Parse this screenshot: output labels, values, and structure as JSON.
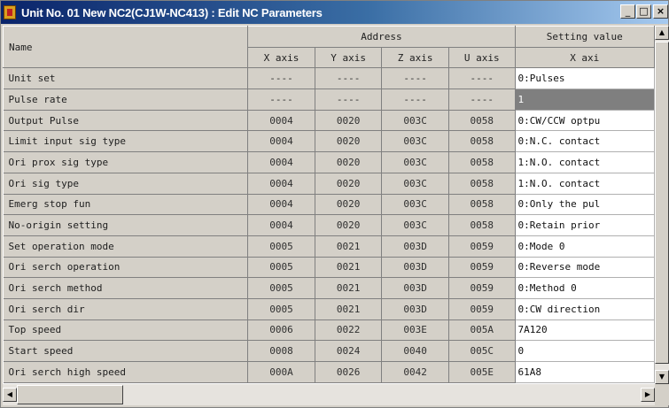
{
  "window": {
    "title": "Unit No. 01 New NC2(CJ1W-NC413) : Edit NC Parameters",
    "buttons": {
      "minimize": "_",
      "maximize": "□",
      "close": "×"
    }
  },
  "grid": {
    "headers": {
      "name": "Name",
      "address": "Address",
      "setting": "Setting value",
      "axes": [
        "X axis",
        "Y axis",
        "Z axis",
        "U axis"
      ],
      "setting_axis": "X axi"
    },
    "rows": [
      {
        "name": "Unit set",
        "addr": [
          "----",
          "----",
          "----",
          "----"
        ],
        "value": "0:Pulses",
        "selected": false
      },
      {
        "name": "Pulse rate",
        "addr": [
          "----",
          "----",
          "----",
          "----"
        ],
        "value": "1",
        "selected": true
      },
      {
        "name": "Output Pulse",
        "addr": [
          "0004",
          "0020",
          "003C",
          "0058"
        ],
        "value": "0:CW/CCW optpu",
        "selected": false
      },
      {
        "name": "Limit input sig type",
        "addr": [
          "0004",
          "0020",
          "003C",
          "0058"
        ],
        "value": "0:N.C. contact",
        "selected": false
      },
      {
        "name": "Ori prox sig type",
        "addr": [
          "0004",
          "0020",
          "003C",
          "0058"
        ],
        "value": "1:N.O. contact",
        "selected": false
      },
      {
        "name": "Ori sig type",
        "addr": [
          "0004",
          "0020",
          "003C",
          "0058"
        ],
        "value": "1:N.O. contact",
        "selected": false
      },
      {
        "name": "Emerg stop fun",
        "addr": [
          "0004",
          "0020",
          "003C",
          "0058"
        ],
        "value": "0:Only the pul",
        "selected": false
      },
      {
        "name": "No-origin setting",
        "addr": [
          "0004",
          "0020",
          "003C",
          "0058"
        ],
        "value": "0:Retain prior",
        "selected": false
      },
      {
        "name": "Set operation mode",
        "addr": [
          "0005",
          "0021",
          "003D",
          "0059"
        ],
        "value": "0:Mode 0",
        "selected": false
      },
      {
        "name": "Ori serch operation",
        "addr": [
          "0005",
          "0021",
          "003D",
          "0059"
        ],
        "value": "0:Reverse mode",
        "selected": false
      },
      {
        "name": "Ori serch method",
        "addr": [
          "0005",
          "0021",
          "003D",
          "0059"
        ],
        "value": "0:Method 0",
        "selected": false
      },
      {
        "name": "Ori serch dir",
        "addr": [
          "0005",
          "0021",
          "003D",
          "0059"
        ],
        "value": "0:CW direction",
        "selected": false
      },
      {
        "name": "Top speed",
        "addr": [
          "0006",
          "0022",
          "003E",
          "005A"
        ],
        "value": "7A120",
        "selected": false
      },
      {
        "name": "Start speed",
        "addr": [
          "0008",
          "0024",
          "0040",
          "005C"
        ],
        "value": "0",
        "selected": false
      },
      {
        "name": "Ori serch high speed",
        "addr": [
          "000A",
          "0026",
          "0042",
          "005E"
        ],
        "value": "61A8",
        "selected": false
      }
    ]
  },
  "icons": {
    "app": "app-icon",
    "scroll_up": "arrow-up-icon",
    "scroll_down": "arrow-down-icon",
    "scroll_left": "arrow-left-icon",
    "scroll_right": "arrow-right-icon"
  }
}
